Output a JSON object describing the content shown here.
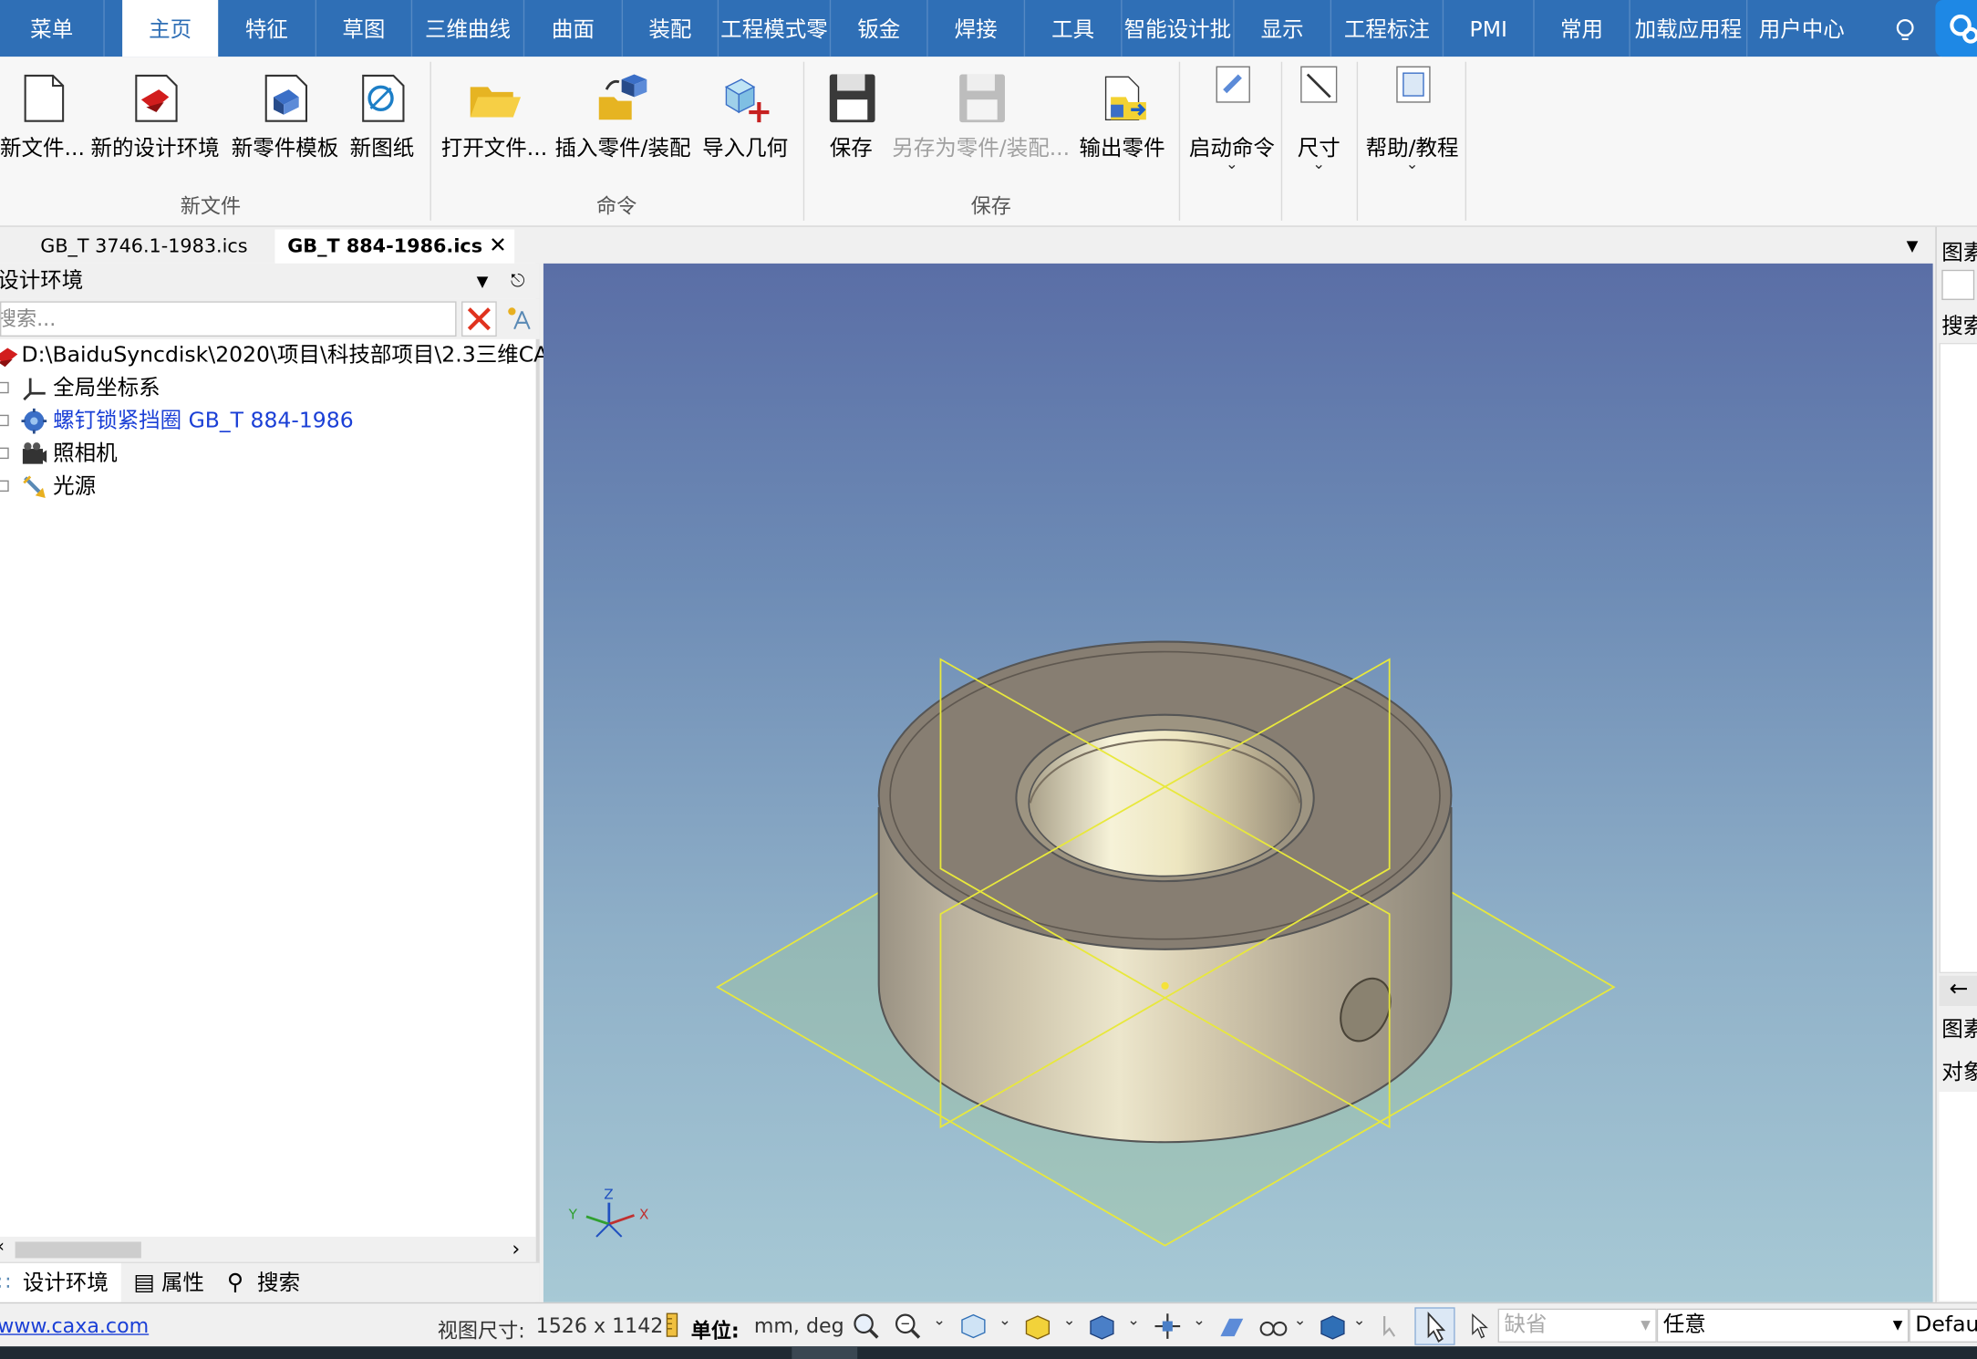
{
  "ribbon_tabs": [
    "菜单",
    "主页",
    "特征",
    "草图",
    "三维曲线",
    "曲面",
    "装配",
    "工程模式零",
    "钣金",
    "焊接",
    "工具",
    "智能设计批",
    "显示",
    "工程标注",
    "PMI",
    "常用",
    "加载应用程",
    "用户中心"
  ],
  "active_tab": "主页",
  "groups": {
    "new_file": {
      "label": "新文件",
      "buttons": [
        "新文件...",
        "新的设计环境",
        "新零件模板",
        "新图纸"
      ]
    },
    "command": {
      "label": "命令",
      "buttons": [
        "打开文件...",
        "插入零件/装配",
        "导入几何"
      ]
    },
    "save": {
      "label": "保存",
      "buttons": [
        "保存",
        "另存为零件/装配...",
        "输出零件"
      ]
    },
    "extra": {
      "start_cmd": "启动命令",
      "dimension": "尺寸",
      "help": "帮助/教程"
    }
  },
  "doc_tabs": [
    "GB_T 3746.1-1983.ics",
    "GB_T 884-1986.ics"
  ],
  "active_doc": "GB_T 884-1986.ics",
  "left_panel": {
    "title": "设计环境",
    "search_placeholder": "搜索...",
    "tree": [
      {
        "label": "D:\\BaiduSyncdisk\\2020\\项目\\科技部项目\\2.3三维CA",
        "icon": "design-env-icon"
      },
      {
        "label": "全局坐标系",
        "icon": "axes-icon"
      },
      {
        "label": "螺钉锁紧挡圈 GB_T 884-1986",
        "icon": "part-icon",
        "highlight": true
      },
      {
        "label": "照相机",
        "icon": "camera-icon"
      },
      {
        "label": "光源",
        "icon": "light-icon"
      }
    ],
    "bottom_tabs": [
      "设计环境",
      "属性",
      "搜索"
    ]
  },
  "right_panel": {
    "title": "图素",
    "search": "搜索",
    "tab1": "图素",
    "tab2": "对象"
  },
  "triad_labels": {
    "z": "Z",
    "x": "X",
    "y": "Y"
  },
  "status": {
    "link": "www.caxa.com",
    "view_size_label": "视图尺寸:",
    "view_size": "1526 x 1142",
    "unit_label": "单位:",
    "unit_value": "mm, deg",
    "filter1": "缺省",
    "filter2": "任意",
    "filter3": "Default"
  },
  "colors": {
    "accent": "#2f6fb6",
    "part": "#b8ad98",
    "datum": "#e8e83c",
    "link": "#1a3fd6"
  }
}
